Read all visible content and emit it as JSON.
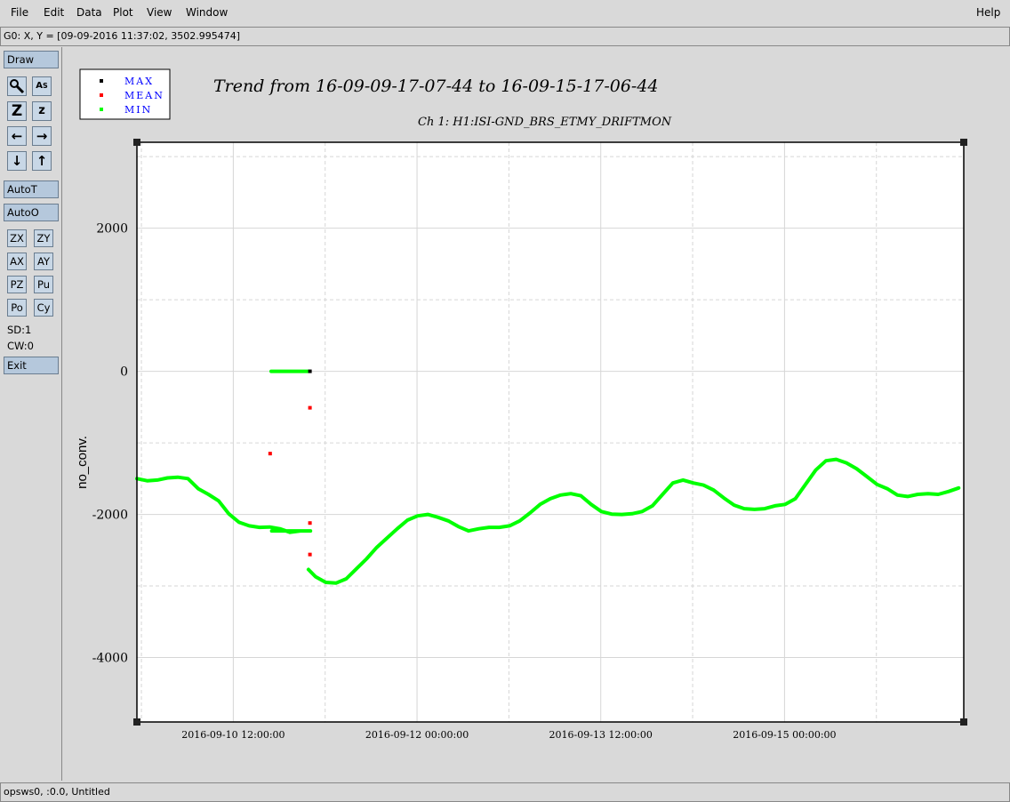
{
  "menu": {
    "items": [
      "File",
      "Edit",
      "Data",
      "Plot",
      "View",
      "Window"
    ],
    "help": "Help"
  },
  "coord_readout": "G0: X, Y = [09-09-2016 11:37:02, 3502.995474]",
  "toolbar": {
    "draw": "Draw",
    "icons": [
      "zoom-in-icon",
      "text-scale-icon",
      "zoom-out-icon",
      "zoom-small-icon",
      "arrow-left-icon",
      "arrow-right-icon",
      "arrow-down-icon",
      "arrow-up-icon"
    ],
    "autot": "AutoT",
    "autoo": "AutoO",
    "small_buttons": [
      "ZX",
      "ZY",
      "AX",
      "AY",
      "PZ",
      "Pu",
      "Po",
      "Cy"
    ],
    "sd": "SD:1",
    "cw": "CW:0",
    "exit": "Exit"
  },
  "status_bar": "opsws0, :0.0, Untitled",
  "colors": {
    "max": "#000000",
    "mean": "#ff0000",
    "min": "#00ff00",
    "legend_text": "#0000ff"
  },
  "chart_data": {
    "type": "line",
    "title": "Trend from 16-09-09-17-07-44 to 16-09-15-17-06-44",
    "subtitle": "Ch 1: H1:ISI-GND_BRS_ETMY_DRIFTMON",
    "xlabel": "",
    "ylabel": "no_conv.",
    "x_tick_labels": [
      "2016-09-10 12:00:00",
      "2016-09-12 00:00:00",
      "2016-09-13 12:00:00",
      "2016-09-15 00:00:00"
    ],
    "x_tick_hours": [
      18.88,
      54.88,
      90.88,
      126.88
    ],
    "xlim_hours": [
      0,
      144
    ],
    "y_ticks": [
      -4000,
      -2000,
      0,
      2000
    ],
    "ylim": [
      -4900,
      3200
    ],
    "grid": true,
    "legend": {
      "placement": "top-left outside",
      "entries": [
        "MAX",
        "MEAN",
        "MIN"
      ]
    },
    "series": [
      {
        "name": "MIN",
        "segments": [
          [
            [
              0,
              -1500
            ],
            [
              2,
              -1530
            ],
            [
              4,
              -1520
            ],
            [
              6,
              -1490
            ],
            [
              8,
              -1480
            ],
            [
              10,
              -1500
            ],
            [
              12,
              -1640
            ],
            [
              14,
              -1720
            ],
            [
              16,
              -1810
            ],
            [
              18,
              -1990
            ],
            [
              20,
              -2110
            ],
            [
              22,
              -2160
            ],
            [
              24,
              -2180
            ],
            [
              26,
              -2175
            ],
            [
              28,
              -2200
            ],
            [
              30,
              -2250
            ],
            [
              32,
              -2230
            ],
            [
              34,
              -2230
            ],
            [
              26.4,
              -2230
            ]
          ],
          [
            [
              26.3,
              0
            ],
            [
              33.6,
              0
            ]
          ],
          [
            [
              33.6,
              -2770
            ],
            [
              35,
              -2870
            ],
            [
              37,
              -2950
            ],
            [
              39,
              -2960
            ],
            [
              41,
              -2900
            ],
            [
              43,
              -2760
            ],
            [
              45,
              -2620
            ],
            [
              47,
              -2460
            ],
            [
              49,
              -2330
            ],
            [
              51,
              -2200
            ],
            [
              53,
              -2080
            ],
            [
              55,
              -2020
            ],
            [
              57,
              -2000
            ],
            [
              59,
              -2040
            ],
            [
              61,
              -2090
            ],
            [
              63,
              -2170
            ],
            [
              65,
              -2230
            ],
            [
              67,
              -2200
            ],
            [
              69,
              -2180
            ],
            [
              71,
              -2180
            ],
            [
              73,
              -2160
            ],
            [
              75,
              -2090
            ],
            [
              77,
              -1980
            ],
            [
              79,
              -1860
            ],
            [
              81,
              -1780
            ],
            [
              83,
              -1730
            ],
            [
              85,
              -1710
            ],
            [
              87,
              -1740
            ],
            [
              89,
              -1860
            ],
            [
              91,
              -1960
            ],
            [
              93,
              -1995
            ],
            [
              95,
              -2000
            ],
            [
              97,
              -1990
            ],
            [
              99,
              -1960
            ],
            [
              101,
              -1880
            ],
            [
              103,
              -1720
            ],
            [
              105,
              -1560
            ],
            [
              107,
              -1520
            ],
            [
              109,
              -1560
            ],
            [
              111,
              -1590
            ],
            [
              113,
              -1660
            ],
            [
              115,
              -1770
            ],
            [
              117,
              -1870
            ],
            [
              119,
              -1920
            ],
            [
              121,
              -1930
            ],
            [
              123,
              -1920
            ],
            [
              125,
              -1880
            ],
            [
              127,
              -1860
            ],
            [
              129,
              -1780
            ],
            [
              131,
              -1580
            ],
            [
              133,
              -1380
            ],
            [
              135,
              -1250
            ],
            [
              137,
              -1230
            ],
            [
              139,
              -1280
            ],
            [
              141,
              -1360
            ],
            [
              143,
              -1470
            ],
            [
              145,
              -1580
            ],
            [
              147,
              -1640
            ],
            [
              149,
              -1730
            ],
            [
              151,
              -1750
            ],
            [
              153,
              -1720
            ],
            [
              155,
              -1710
            ],
            [
              157,
              -1720
            ],
            [
              159,
              -1680
            ],
            [
              161,
              -1630
            ]
          ]
        ]
      },
      {
        "name": "MEAN",
        "points": [
          [
            26.1,
            -1150
          ],
          [
            33.9,
            -510
          ],
          [
            33.9,
            -2120
          ],
          [
            33.9,
            -2560
          ]
        ]
      },
      {
        "name": "MAX",
        "points": [
          [
            33.9,
            0
          ]
        ]
      }
    ]
  }
}
